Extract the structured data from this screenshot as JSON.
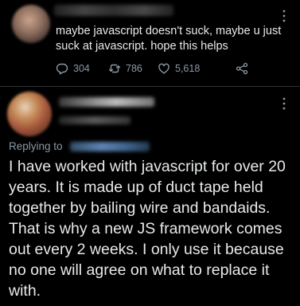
{
  "original_tweet": {
    "text": "maybe javascript doesn't suck, maybe u just suck at javascript. hope this helps",
    "metrics": {
      "replies": "304",
      "retweets": "786",
      "likes": "5,618"
    },
    "icons": [
      "reply-icon",
      "retweet-icon",
      "like-icon",
      "share-icon"
    ]
  },
  "reply_tweet": {
    "replying_to_label": "Replying to",
    "text": "I have worked with javascript for over 20 years. It is made up of duct tape held together by bailing wire and bandaids. That is why a new JS framework comes out every 2 weeks. I only use it because no one will agree on what to replace it with."
  },
  "colors": {
    "background": "#000000",
    "text_primary": "#e7e9ea",
    "text_secondary": "#8b98a5",
    "divider": "#2f3336"
  }
}
